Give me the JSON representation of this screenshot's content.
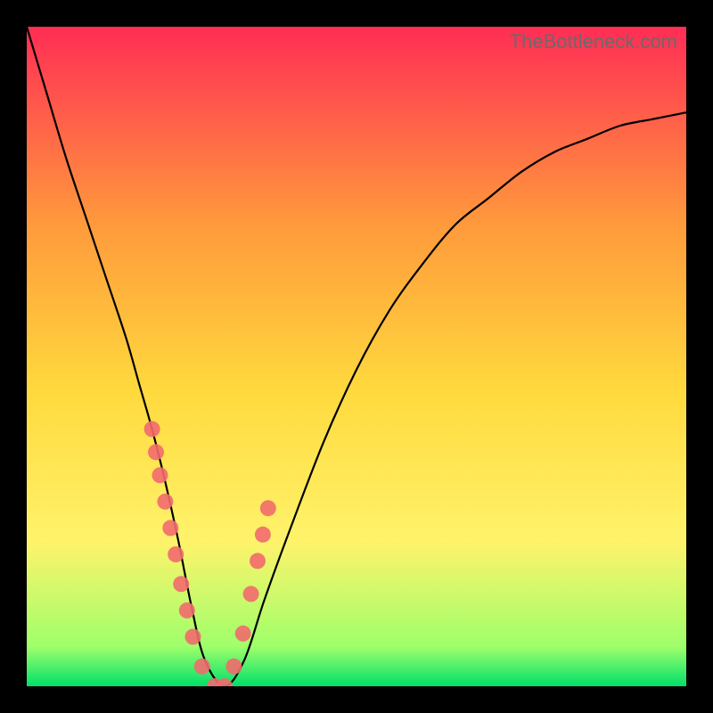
{
  "watermark": "TheBottleneck.com",
  "colors": {
    "frame": "#000000",
    "curve": "#000000",
    "marker": "#f26a6e",
    "gradient_top": "#ff2d55",
    "gradient_mid_upper": "#ff9a3c",
    "gradient_mid": "#ffd93d",
    "gradient_mid_lower": "#fff36b",
    "gradient_green_band": "#9fff6b",
    "gradient_bottom": "#00e06a"
  },
  "chart_data": {
    "type": "line",
    "title": "",
    "xlabel": "",
    "ylabel": "",
    "xlim": [
      0,
      100
    ],
    "ylim": [
      0,
      100
    ],
    "series": [
      {
        "name": "bottleneck-curve",
        "x": [
          0,
          3,
          6,
          9,
          12,
          15,
          17,
          19,
          21,
          23,
          25,
          27,
          30,
          33,
          36,
          40,
          45,
          50,
          55,
          60,
          65,
          70,
          75,
          80,
          85,
          90,
          95,
          100
        ],
        "y": [
          100,
          90,
          80,
          71,
          62,
          53,
          46,
          39,
          31,
          22,
          12,
          4,
          0,
          4,
          13,
          24,
          37,
          48,
          57,
          64,
          70,
          74,
          78,
          81,
          83,
          85,
          86,
          87
        ]
      }
    ],
    "markers": {
      "name": "highlighted-points",
      "x": [
        19.0,
        19.6,
        20.2,
        21.0,
        21.8,
        22.6,
        23.4,
        24.3,
        25.2,
        26.6,
        28.5,
        30.0,
        31.4,
        32.8,
        34.0,
        35.0,
        35.8,
        36.6
      ],
      "y": [
        39.0,
        35.5,
        32.0,
        28.0,
        24.0,
        20.0,
        15.5,
        11.5,
        7.5,
        3.0,
        0.0,
        0.0,
        3.0,
        8.0,
        14.0,
        19.0,
        23.0,
        27.0
      ]
    }
  }
}
